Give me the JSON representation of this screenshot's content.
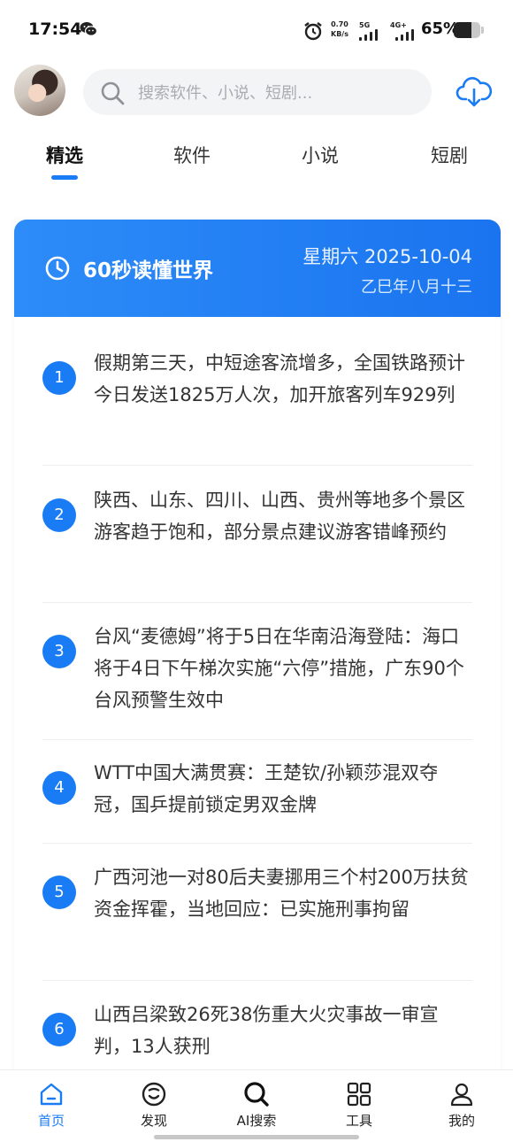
{
  "status_bar": {
    "time": "17:54",
    "net_speed_value": "0.70",
    "net_speed_unit": "KB/s",
    "sim1": "5G",
    "sim2": "4G+",
    "battery_text": "65%",
    "battery_level": 0.65,
    "icons": [
      "wechat-icon",
      "alarm-icon",
      "signal-icon",
      "battery-icon"
    ]
  },
  "header": {
    "search_placeholder": "搜索软件、小说、短剧...",
    "search_value": ""
  },
  "tabs": [
    {
      "label": "精选",
      "active": true
    },
    {
      "label": "软件",
      "active": false
    },
    {
      "label": "小说",
      "active": false
    },
    {
      "label": "短剧",
      "active": false
    }
  ],
  "card": {
    "title": "60秒读懂世界",
    "date": "星期六 2025-10-04",
    "lunar": "乙巳年八月十三",
    "news": [
      {
        "num": "1",
        "text": "假期第三天，中短途客流增多，全国铁路预计今日发送1825万人次，加开旅客列车929列"
      },
      {
        "num": "2",
        "text": "陕西、山东、四川、山西、贵州等地多个景区游客趋于饱和，部分景点建议游客错峰预约"
      },
      {
        "num": "3",
        "text": "台风“麦德姆”将于5日在华南沿海登陆：海口将于4日下午梯次实施“六停”措施，广东90个台风预警生效中"
      },
      {
        "num": "4",
        "text": "WTT中国大满贯赛：王楚钦/孙颖莎混双夺冠，国乒提前锁定男双金牌"
      },
      {
        "num": "5",
        "text": "广西河池一对80后夫妻挪用三个村200万扶贫资金挥霍，当地回应：已实施刑事拘留"
      },
      {
        "num": "6",
        "text": "山西吕梁致26死38伤重大火灾事故一审宣判，13人获刑"
      }
    ]
  },
  "bottom_nav": [
    {
      "label": "首页",
      "icon": "home-icon",
      "active": true
    },
    {
      "label": "发现",
      "icon": "discover-icon",
      "active": false
    },
    {
      "label": "AI搜索",
      "icon": "ai-search-icon",
      "active": false
    },
    {
      "label": "工具",
      "icon": "tools-icon",
      "active": false
    },
    {
      "label": "我的",
      "icon": "profile-icon",
      "active": false
    }
  ],
  "colors": {
    "accent": "#1a7cf5",
    "header_gradient_start": "#2d8cf8",
    "header_gradient_end": "#1a74ef"
  }
}
